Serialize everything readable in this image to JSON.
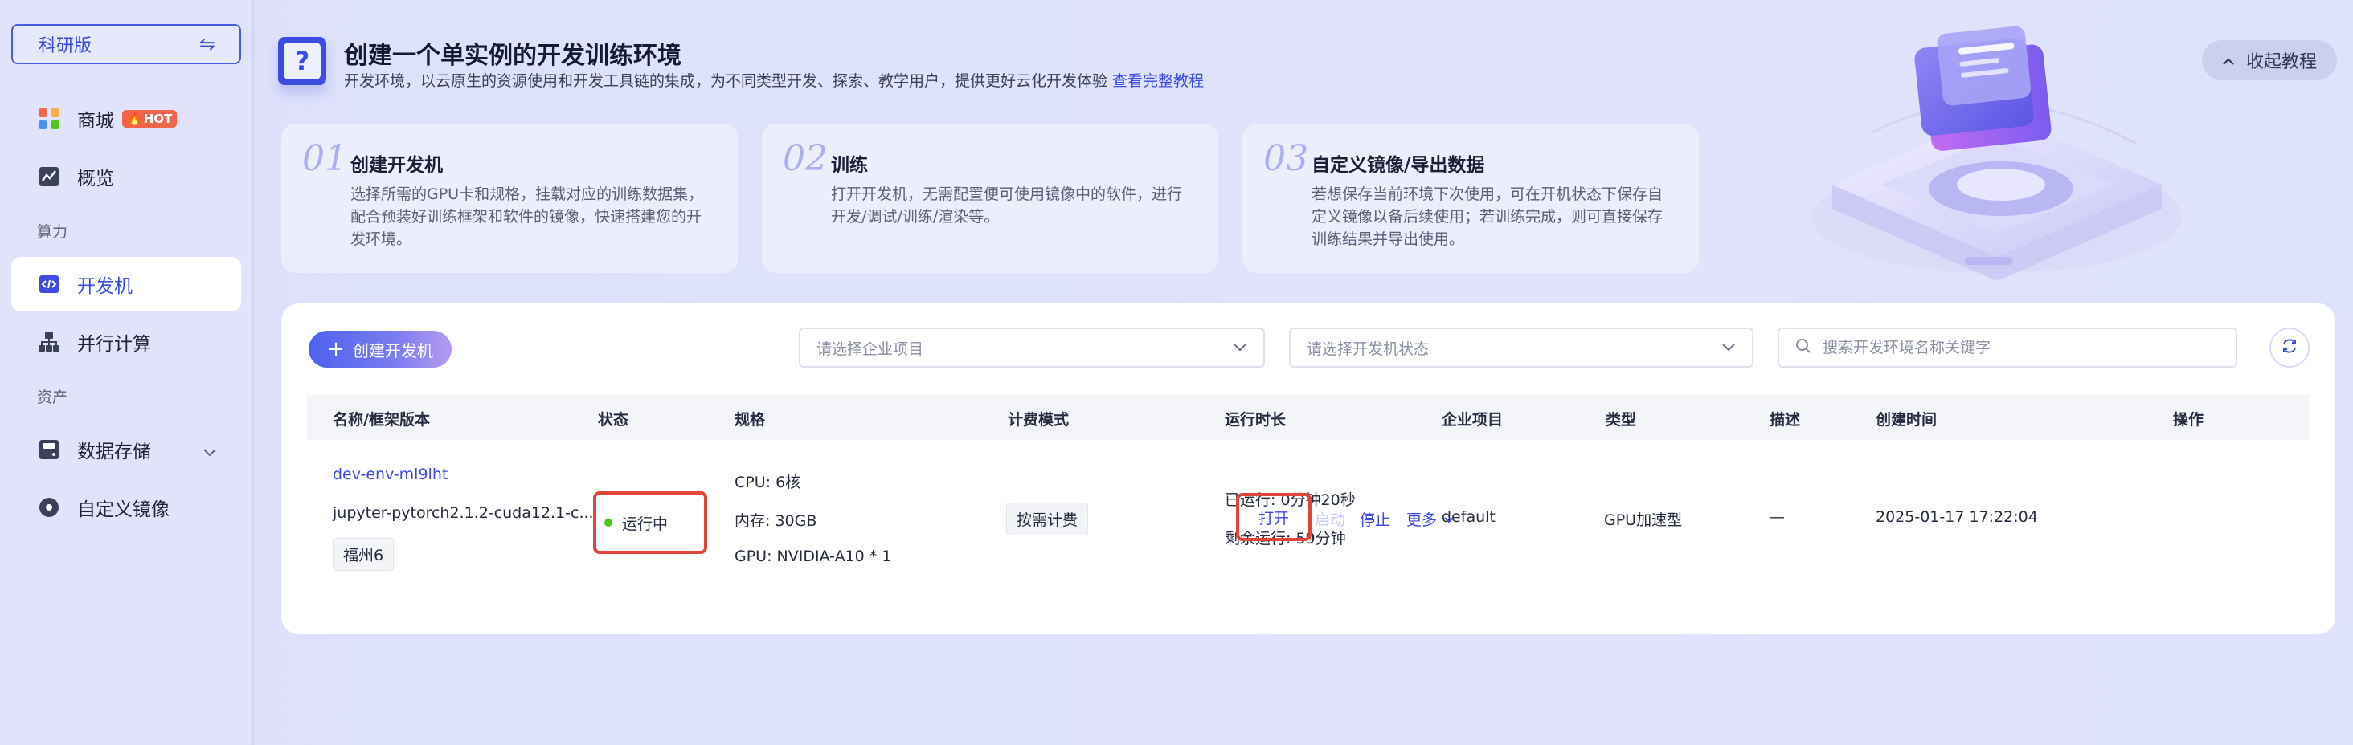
{
  "sidebar": {
    "edition": "科研版",
    "items": [
      {
        "label": "商城",
        "badge": "HOT"
      },
      {
        "label": "概览"
      },
      {
        "label": "开发机"
      },
      {
        "label": "并行计算"
      },
      {
        "label": "数据存储"
      },
      {
        "label": "自定义镜像"
      }
    ],
    "sections": [
      "算力",
      "资产"
    ]
  },
  "header": {
    "title": "创建一个单实例的开发训练环境",
    "subtitle": "开发环境，以云原生的资源使用和开发工具链的集成，为不同类型开发、探索、教学用户，提供更好云化开发体验",
    "tutorial_link": "查看完整教程",
    "collapse_label": "收起教程"
  },
  "steps": [
    {
      "num": "01",
      "title": "创建开发机",
      "desc": "选择所需的GPU卡和规格，挂载对应的训练数据集，配合预装好训练框架和软件的镜像，快速搭建您的开发环境。"
    },
    {
      "num": "02",
      "title": "训练",
      "desc": "打开开发机，无需配置便可使用镜像中的软件，进行开发/调试/训练/渲染等。"
    },
    {
      "num": "03",
      "title": "自定义镜像/导出数据",
      "desc": "若想保存当前环境下次使用，可在开机状态下保存自定义镜像以备后续使用；若训练完成，则可直接保存训练结果并导出使用。"
    }
  ],
  "toolbar": {
    "create_label": "创建开发机",
    "project_placeholder": "请选择企业项目",
    "status_placeholder": "请选择开发机状态",
    "search_placeholder": "搜索开发环境名称关键字"
  },
  "table": {
    "columns": [
      "名称/框架版本",
      "状态",
      "规格",
      "计费模式",
      "运行时长",
      "企业项目",
      "类型",
      "描述",
      "创建时间",
      "操作"
    ],
    "rows": [
      {
        "name": "dev-env-ml9lht",
        "framework": "jupyter-pytorch2.1.2-cuda12.1-c...",
        "region": "福州6",
        "status": "运行中",
        "spec_cpu": "CPU: 6核",
        "spec_mem": "内存: 30GB",
        "spec_gpu": "GPU: NVIDIA-A10 * 1",
        "billing": "按需计费",
        "runtime_used": "已运行: 0分钟20秒",
        "runtime_left": "剩余运行: 59分钟",
        "project": "default",
        "type": "GPU加速型",
        "desc": "—",
        "created": "2025-01-17 17:22:04",
        "actions": {
          "open": "打开",
          "start": "启动",
          "stop": "停止",
          "more": "更多"
        }
      }
    ]
  },
  "colors": {
    "accent": "#3c4ce2",
    "highlight": "#e0443a",
    "running": "#52c41a",
    "hot": "#f0654a"
  }
}
